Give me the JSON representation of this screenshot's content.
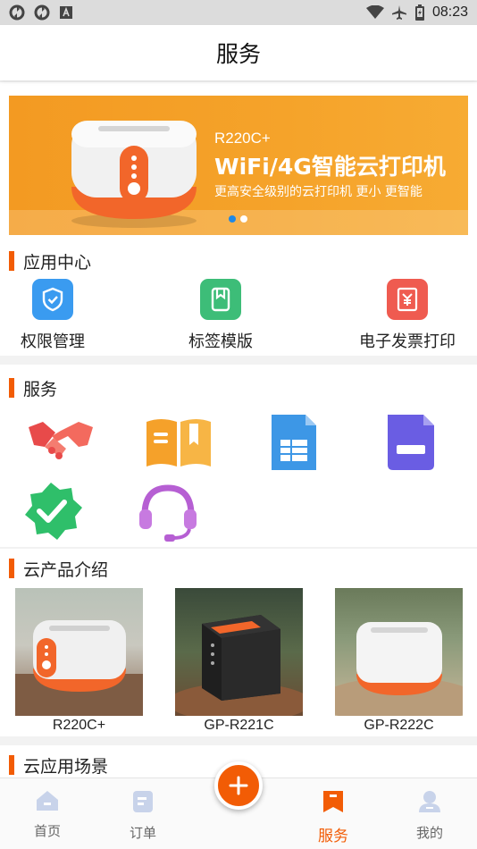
{
  "status_bar": {
    "time": "08:23",
    "icons": [
      "sync-icon",
      "sync-icon",
      "text-icon",
      "wifi-icon",
      "airplane-icon",
      "battery-icon"
    ]
  },
  "header": {
    "title": "服务"
  },
  "banner": {
    "model": "R220C+",
    "headline": "WiFi/4G智能云打印机",
    "subline": "更高安全级别的云打印机 更小 更智能",
    "slides": 2,
    "active_slide": 0
  },
  "app_center": {
    "title": "应用中心",
    "items": [
      {
        "label": "权限管理",
        "icon": "shield-icon",
        "color": "#3a9bf0"
      },
      {
        "label": "标签模版",
        "icon": "bookmark-icon",
        "color": "#3dbd78"
      },
      {
        "label": "电子发票打印",
        "icon": "invoice-icon",
        "color": "#ef5b50"
      }
    ]
  },
  "services": {
    "title": "服务",
    "items": [
      {
        "icon": "handshake-icon"
      },
      {
        "icon": "open-book-icon"
      },
      {
        "icon": "spreadsheet-icon"
      },
      {
        "icon": "document-icon"
      },
      {
        "icon": "badge-check-icon"
      },
      {
        "icon": "headset-icon"
      }
    ]
  },
  "cloud_products": {
    "title": "云产品介绍",
    "items": [
      {
        "name": "R220C+"
      },
      {
        "name": "GP-R221C"
      },
      {
        "name": "GP-R222C"
      }
    ]
  },
  "cloud_scenes": {
    "title": "云应用场景"
  },
  "bottom_nav": {
    "items": [
      {
        "label": "首页",
        "icon": "home-icon"
      },
      {
        "label": "订单",
        "icon": "order-icon"
      },
      {
        "label": "服务",
        "icon": "service-icon",
        "active": true
      },
      {
        "label": "我的",
        "icon": "profile-icon"
      }
    ],
    "fab_icon": "plus-icon"
  },
  "colors": {
    "accent": "#f25c05",
    "banner": "#f5a32a",
    "active_dot": "#1e88e5"
  }
}
